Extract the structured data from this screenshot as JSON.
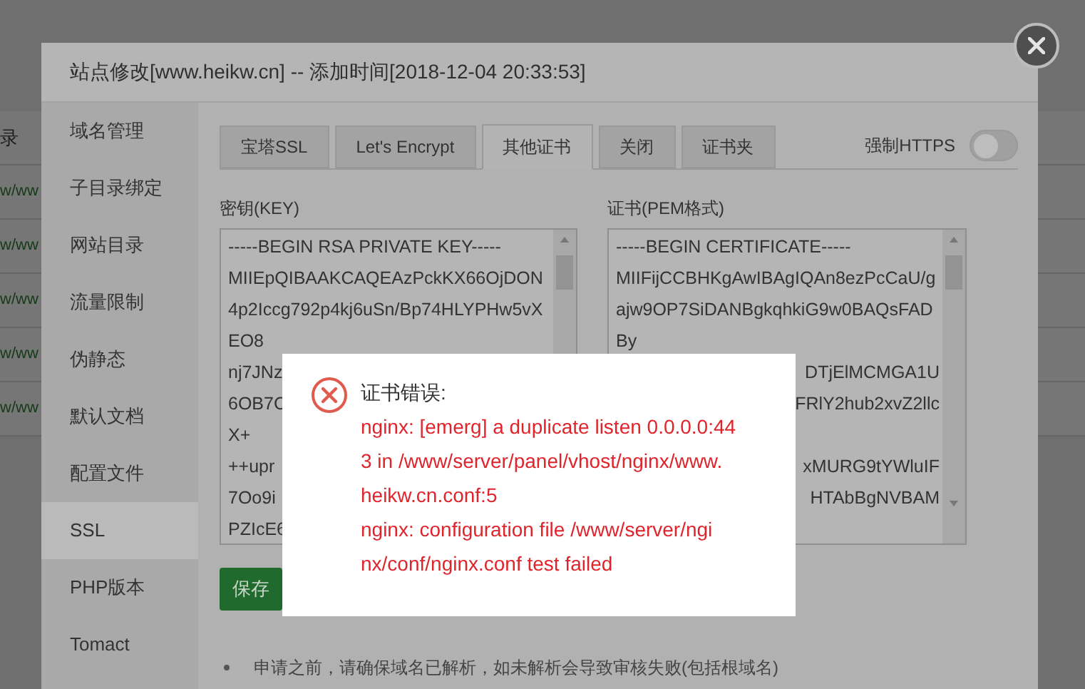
{
  "background_page": {
    "rows": [
      "录",
      "w/ww",
      "w/ww",
      "w/ww",
      "w/ww",
      "w/ww"
    ]
  },
  "dialog": {
    "title": "站点修改[www.heikw.cn] -- 添加时间[2018-12-04 20:33:53]",
    "sidebar": [
      {
        "label": "域名管理",
        "selected": false
      },
      {
        "label": "子目录绑定",
        "selected": false
      },
      {
        "label": "网站目录",
        "selected": false
      },
      {
        "label": "流量限制",
        "selected": false
      },
      {
        "label": "伪静态",
        "selected": false
      },
      {
        "label": "默认文档",
        "selected": false
      },
      {
        "label": "配置文件",
        "selected": false
      },
      {
        "label": "SSL",
        "selected": true
      },
      {
        "label": "PHP版本",
        "selected": false
      },
      {
        "label": "Tomact",
        "selected": false
      }
    ],
    "tabs": [
      {
        "label": "宝塔SSL",
        "selected": false
      },
      {
        "label": "Let's Encrypt",
        "selected": false
      },
      {
        "label": "其他证书",
        "selected": true
      },
      {
        "label": "关闭",
        "selected": false
      },
      {
        "label": "证书夹",
        "selected": false
      }
    ],
    "force_https": {
      "label": "强制HTTPS",
      "on": false
    },
    "key": {
      "label": "密钥(KEY)",
      "lines": [
        {
          "text": "-----BEGIN RSA PRIVATE KEY-----"
        },
        {
          "text": "MIIEpQIBAAKCAQEAzPckKX66OjDON"
        },
        {
          "text": "4p2Iccg792p4kj6uSn/Bp74HLYPHw5vX"
        },
        {
          "text": "EO8"
        },
        {
          "text": "nj7JNz"
        },
        {
          "text": "6OB7C"
        },
        {
          "text": "X+"
        },
        {
          "text": "++upr"
        },
        {
          "text": "7Oo9i"
        },
        {
          "text": "PZIcE6"
        }
      ]
    },
    "certificate": {
      "label": "证书(PEM格式)",
      "lines": [
        {
          "text": "-----BEGIN CERTIFICATE-----",
          "kind": "full"
        },
        {
          "text": "MIIFijCCBHKgAwIBAgIQAn8ezPcCaU/g",
          "kind": "full"
        },
        {
          "text": "ajw9OP7SiDANBgkqhkiG9w0BAQsFAD",
          "kind": "full"
        },
        {
          "text": "By",
          "kind": "full"
        },
        {
          "text": "DTjElMCMGA1U",
          "kind": "tail"
        },
        {
          "text": "FRlY2hub2xvZ2llc",
          "kind": "tail"
        },
        {
          "text": "xMURG9tYWluIF",
          "kind": "tail",
          "gap_before": true
        },
        {
          "text": "HTAbBgNVBAM",
          "kind": "tail"
        }
      ]
    },
    "save_button": "保存",
    "note": "申请之前，请确保域名已解析，如未解析会导致审核失败(包括根域名)"
  },
  "error_popup": {
    "title": "证书错误:",
    "lines": [
      "nginx: [emerg] a duplicate listen 0.0.0.0:44",
      "3 in /www/server/panel/vhost/nginx/www.",
      "heikw.cn.conf:5",
      "nginx: configuration file /www/server/ngi",
      "nx/conf/nginx.conf test failed"
    ]
  }
}
